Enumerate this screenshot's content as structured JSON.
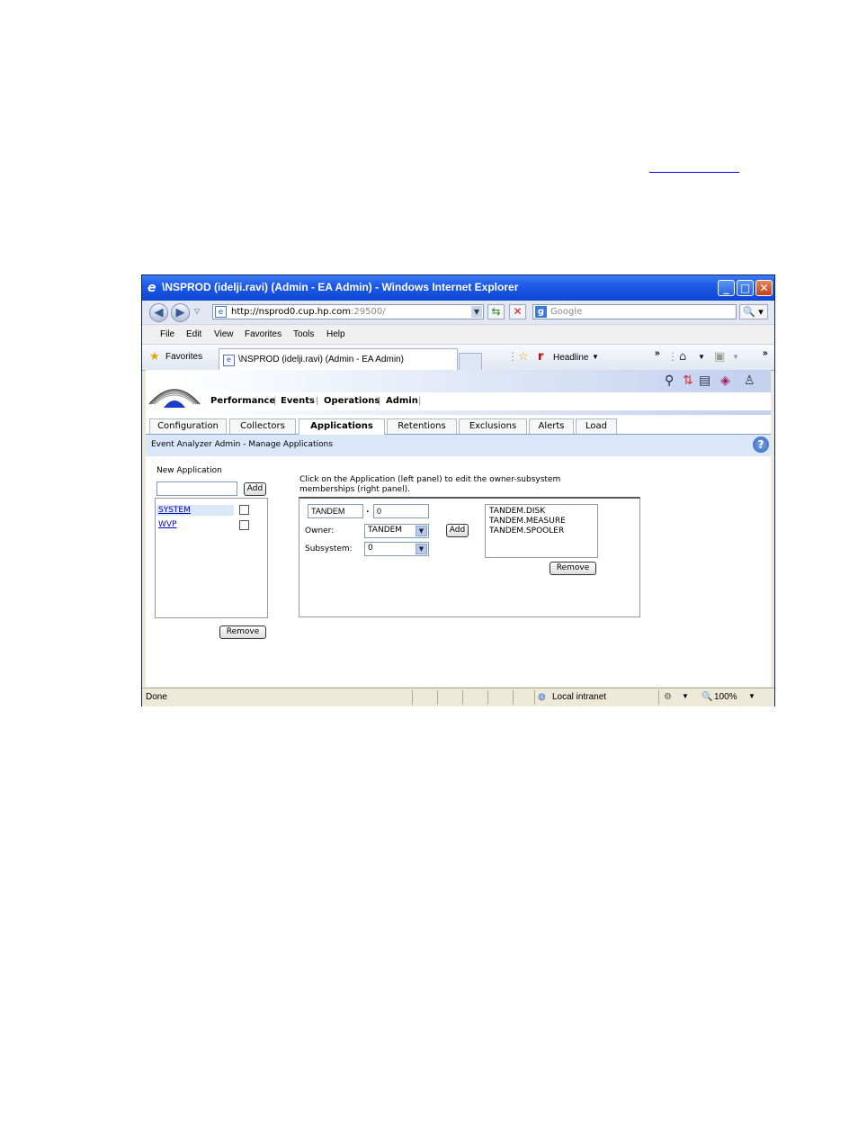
{
  "browser": {
    "title": "\\NSPROD (idelji.ravi) (Admin - EA Admin) - Windows Internet Explorer",
    "url_host": "http://nsprod0.cup.hp.com",
    "url_port": ":29500/",
    "search_placeholder": "Google",
    "menu": [
      "File",
      "Edit",
      "View",
      "Favorites",
      "Tools",
      "Help"
    ],
    "favorites_label": "Favorites",
    "tab_title": "\\NSPROD (idelji.ravi) (Admin - EA Admin)",
    "headline_label": "Headline",
    "status": {
      "text": "Done",
      "zone": "Local intranet",
      "zoom": "100%"
    }
  },
  "app": {
    "main_nav": [
      "Performance",
      "Events",
      "Operations",
      "Admin"
    ],
    "sub_tabs": [
      "Configuration",
      "Collectors",
      "Applications",
      "Retentions",
      "Exclusions",
      "Alerts",
      "Load"
    ],
    "active_sub_tab": "Applications",
    "breadcrumb": "Event Analyzer Admin - Manage Applications",
    "left_panel": {
      "new_label": "New Application",
      "new_value": "",
      "add_label": "Add",
      "applications": [
        "SYSTEM",
        "WVP"
      ],
      "remove_label": "Remove"
    },
    "right_panel": {
      "instruction": "Click on the Application (left panel) to edit the owner-subsystem memberships (right panel).",
      "owner_value": "TANDEM",
      "dot": ".",
      "subsystem_value": "0",
      "owner_label": "Owner:",
      "owner_select": "TANDEM",
      "subsystem_label": "Subsystem:",
      "subsystem_select": "0",
      "add_label": "Add",
      "members": [
        "TANDEM.DISK",
        "TANDEM.MEASURE",
        "TANDEM.SPOOLER"
      ],
      "remove_label": "Remove"
    }
  }
}
